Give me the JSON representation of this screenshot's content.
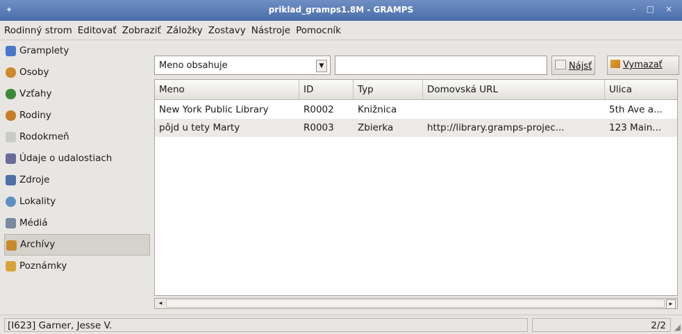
{
  "window": {
    "title": "priklad_gramps1.8M - GRAMPS",
    "controls": "- □ ×"
  },
  "menu": [
    "Rodinný strom",
    "Editovať",
    "Zobraziť",
    "Záložky",
    "Zostavy",
    "Nástroje",
    "Pomocník"
  ],
  "sidebar": {
    "items": [
      {
        "label": "Gramplety",
        "color": "#4a78c9"
      },
      {
        "label": "Osoby",
        "color": "#d08a2a"
      },
      {
        "label": "Vzťahy",
        "color": "#3a8a3a"
      },
      {
        "label": "Rodiny",
        "color": "#c77d26"
      },
      {
        "label": "Rodokmeň",
        "color": "#9fa5a0"
      },
      {
        "label": "Údaje o udalostiach",
        "color": "#6b6b9a"
      },
      {
        "label": "Zdroje",
        "color": "#4b6fa8"
      },
      {
        "label": "Lokality",
        "color": "#5e8fc0"
      },
      {
        "label": "Médiá",
        "color": "#7a8aa0"
      },
      {
        "label": "Archívy",
        "color": "#c98a2b"
      },
      {
        "label": "Poznámky",
        "color": "#d8a43a"
      }
    ],
    "selected": "Archívy"
  },
  "filter": {
    "combo_value": "Meno obsahuje",
    "search_value": "",
    "find_label": "Nájsť",
    "clear_label": "Vymazať"
  },
  "table": {
    "columns": [
      "Meno",
      "ID",
      "Typ",
      "Domovská URL",
      "Ulica"
    ],
    "rows": [
      [
        "New York Public Library",
        "R0002",
        "Knižnica",
        "",
        "5th Ave a..."
      ],
      [
        "pôjd u tety Marty",
        "R0003",
        "Zbierka",
        "http://library.gramps-projec...",
        "123 Main..."
      ]
    ]
  },
  "status": {
    "message": "[I623] Garner, Jesse V.",
    "count": "2/2"
  }
}
